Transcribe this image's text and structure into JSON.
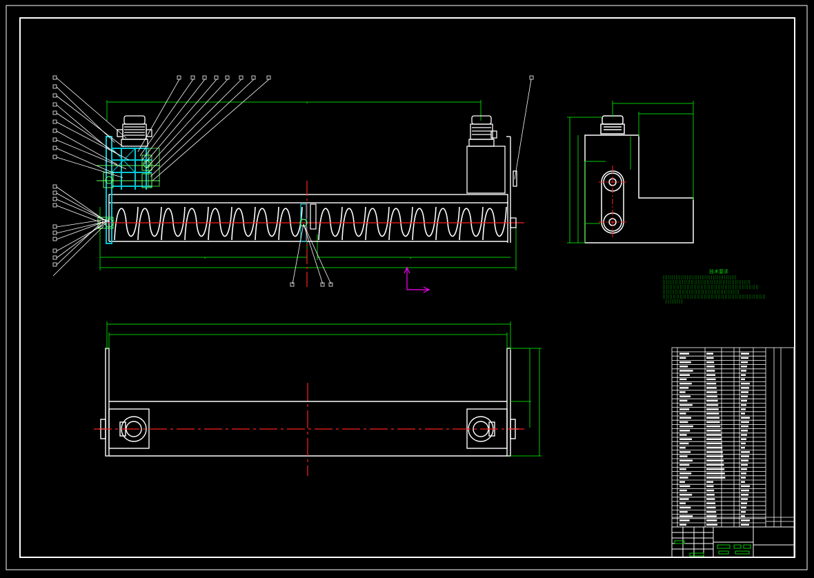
{
  "drawing": {
    "title": "",
    "background_color": "#000000",
    "line_colors": {
      "outline": "#ffffff",
      "dimension": "#00cc00",
      "centerline": "#ff2020",
      "frame_cyan": "#00c8d8",
      "chain_green": "#66ff66",
      "ucs_icon": "#ff00ff"
    }
  },
  "notes": {
    "heading": "技术要求",
    "lines": [
      "||||||||||||||||||||||||||||||||||||||||",
      "||||||||||||||||||||||||||||||||||||||||||||||||||",
      "||||||||||||||||||||||||||||||||||||||||||||||||||||||||",
      "||||||||||||||||||||||||||||||||||||||||||||",
      "||||||||||||||||||||||||||||||||||||||||||||||||||||||||||||",
      "||||||||"
    ]
  },
  "icons": {
    "ucs": "ucs-axis-icon"
  }
}
